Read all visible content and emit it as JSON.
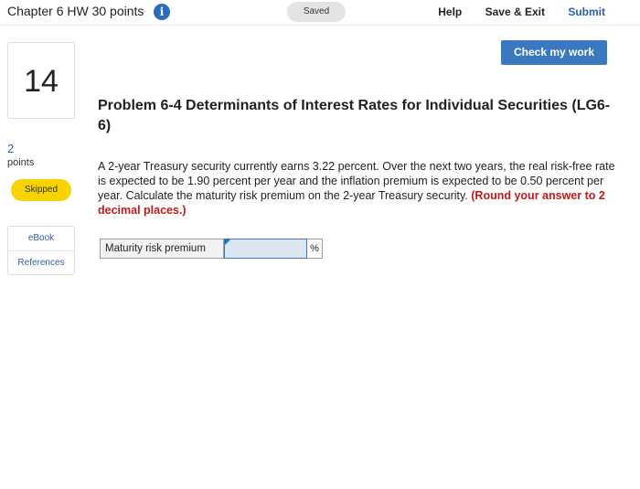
{
  "header": {
    "assignment_title": "Chapter 6 HW 30 points",
    "info_icon": "info-icon",
    "status": "Saved",
    "links": {
      "help": "Help",
      "save_exit": "Save & Exit",
      "submit": "Submit"
    }
  },
  "check_button": "Check my work",
  "question": {
    "number": "14",
    "points_value": "2",
    "points_label": "points",
    "status_badge": "Skipped"
  },
  "resources": {
    "ebook": "eBook",
    "references": "References"
  },
  "problem": {
    "title": "Problem 6-4 Determinants of Interest Rates for Individual Securities (LG6-6)",
    "body": "A 2-year Treasury security currently earns 3.22 percent. Over the next two years, the real risk-free rate is expected to be 1.90 percent per year and the inflation premium is expected to be 0.50 percent per year. Calculate the maturity risk premium on the 2-year Treasury security.",
    "instruction": "(Round your answer to 2 decimal places.)"
  },
  "answer": {
    "label": "Maturity risk premium",
    "value": "",
    "unit": "%"
  },
  "colors": {
    "accent": "#3a79c0",
    "link": "#2a5ea8",
    "skipped": "#f7d400",
    "emphasis": "#c01a1a"
  }
}
